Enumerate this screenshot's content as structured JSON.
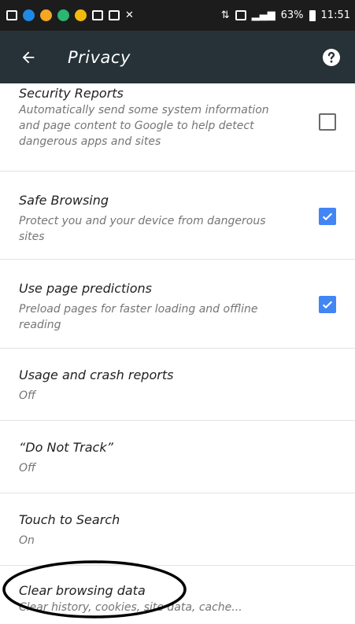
{
  "status_bar": {
    "battery_percent": "63%",
    "time": "11:51"
  },
  "toolbar": {
    "title": "Privacy",
    "back_icon": "arrow-back-icon",
    "help_icon": "help-icon"
  },
  "settings": [
    {
      "title": "Security Reports",
      "summary": "Automatically send some system information and page content to Google to help detect dangerous apps and sites",
      "checked": false
    },
    {
      "title": "Safe Browsing",
      "summary": "Protect you and your device from dangerous sites",
      "checked": true
    },
    {
      "title": "Use page predictions",
      "summary": "Preload pages for faster loading and offline reading",
      "checked": true
    },
    {
      "title": "Usage and crash reports",
      "summary": "Off"
    },
    {
      "title": "“Do Not Track”",
      "summary": "Off"
    },
    {
      "title": "Touch to Search",
      "summary": "On"
    },
    {
      "title": "Clear browsing data",
      "summary": "Clear history, cookies, site data, cache..."
    }
  ],
  "colors": {
    "toolbar": "#263238",
    "status_bar": "#1c1c1c",
    "checkbox_checked": "#4285f4"
  }
}
